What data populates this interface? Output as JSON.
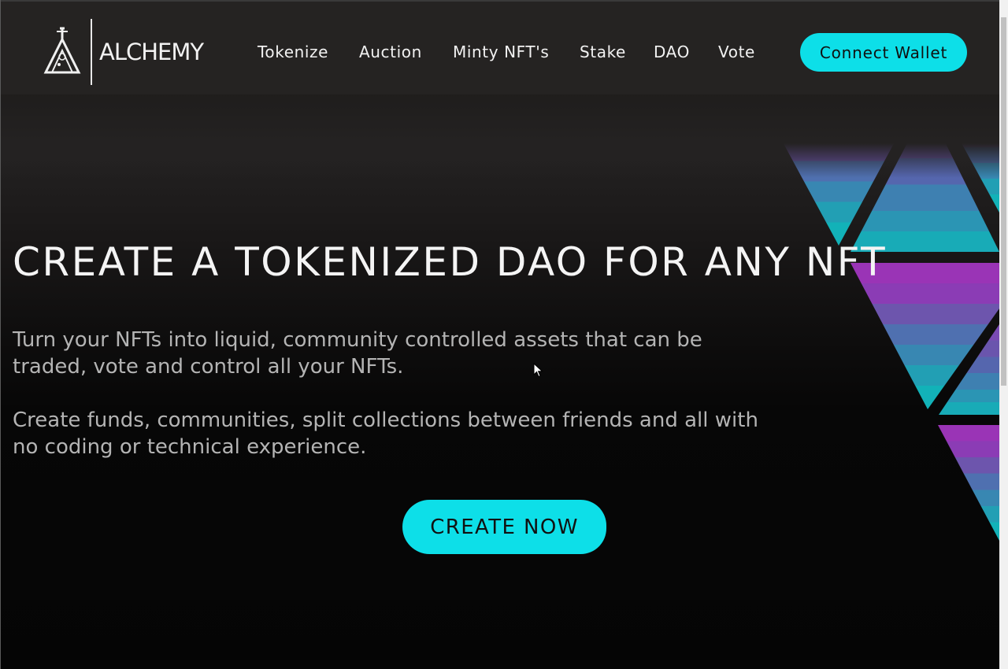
{
  "brand": {
    "name": "ALCHEMY",
    "logo_icon": "flask-icon"
  },
  "nav": {
    "items": [
      {
        "label": "Tokenize"
      },
      {
        "label": "Auction"
      },
      {
        "label": "Minty NFT's"
      },
      {
        "label": "Stake"
      },
      {
        "label": "DAO"
      },
      {
        "label": "Vote"
      }
    ],
    "connect_label": "Connect Wallet"
  },
  "hero": {
    "title": "CREATE A TOKENIZED DAO FOR ANY NFT",
    "paragraph_1": "Turn your NFTs into liquid, community controlled assets that can be traded, vote and control all your NFTs.",
    "paragraph_2": "Create funds, communities, split collections between friends and all with no coding or technical experience.",
    "cta_label": "CREATE NOW"
  },
  "colors": {
    "accent": "#0ddfe8",
    "background": "#050505",
    "header": "#252322",
    "triangle_top": "#9b35b5",
    "triangle_bottom": "#0fb3b8"
  }
}
